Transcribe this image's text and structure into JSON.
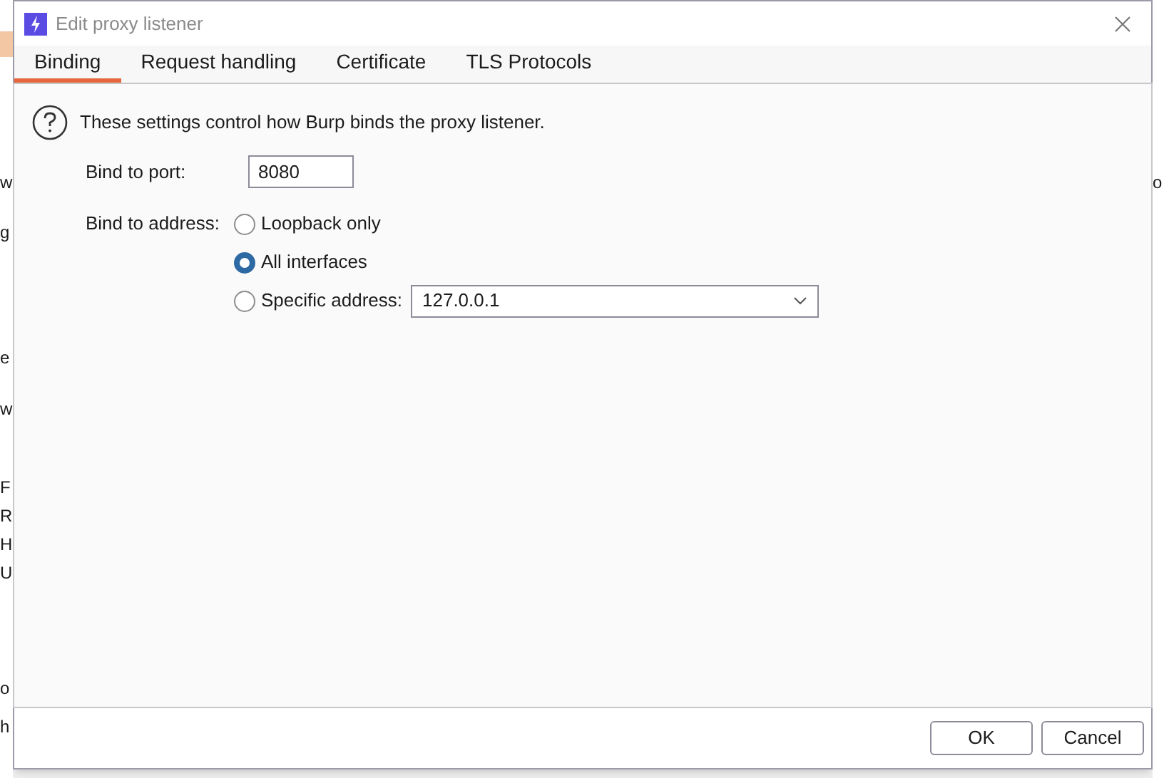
{
  "background": {
    "left_fragments": [
      "w",
      "g",
      "e",
      "w",
      "F",
      "R",
      "H",
      "U",
      "o",
      "h"
    ],
    "right_fragments": [
      "o"
    ]
  },
  "window": {
    "title": "Edit proxy listener"
  },
  "tabs": [
    {
      "label": "Binding",
      "selected": true
    },
    {
      "label": "Request handling",
      "selected": false
    },
    {
      "label": "Certificate",
      "selected": false
    },
    {
      "label": "TLS Protocols",
      "selected": false
    }
  ],
  "intro": "These settings control how Burp binds the proxy listener.",
  "port": {
    "label": "Bind to port:",
    "value": "8080"
  },
  "address": {
    "label": "Bind to address:",
    "options": [
      {
        "label": "Loopback only",
        "selected": false
      },
      {
        "label": "All interfaces",
        "selected": true
      },
      {
        "label": "Specific address:",
        "selected": false,
        "value": "127.0.0.1"
      }
    ]
  },
  "buttons": [
    "OK",
    "Cancel"
  ]
}
